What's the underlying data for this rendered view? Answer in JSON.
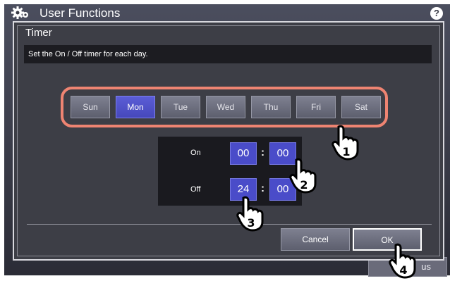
{
  "app": {
    "title": "User Functions",
    "help_label": "?",
    "bottom_button_label": "us"
  },
  "dialog": {
    "title": "Timer",
    "message": "Set the On / Off timer for each day.",
    "days": [
      {
        "label": "Sun",
        "selected": false
      },
      {
        "label": "Mon",
        "selected": true
      },
      {
        "label": "Tue",
        "selected": false
      },
      {
        "label": "Wed",
        "selected": false
      },
      {
        "label": "Thu",
        "selected": false
      },
      {
        "label": "Fri",
        "selected": false
      },
      {
        "label": "Sat",
        "selected": false
      }
    ],
    "on": {
      "label": "On",
      "hour": "00",
      "minute": "00"
    },
    "off": {
      "label": "Off",
      "hour": "24",
      "minute": "00"
    },
    "colon": ":",
    "cancel_label": "Cancel",
    "ok_label": "OK"
  },
  "callouts": [
    "1",
    "2",
    "3",
    "4"
  ],
  "colors": {
    "selected_day": "#4b4dcb",
    "highlight_ring": "#ef8472",
    "time_field": "#4a4cc9"
  }
}
